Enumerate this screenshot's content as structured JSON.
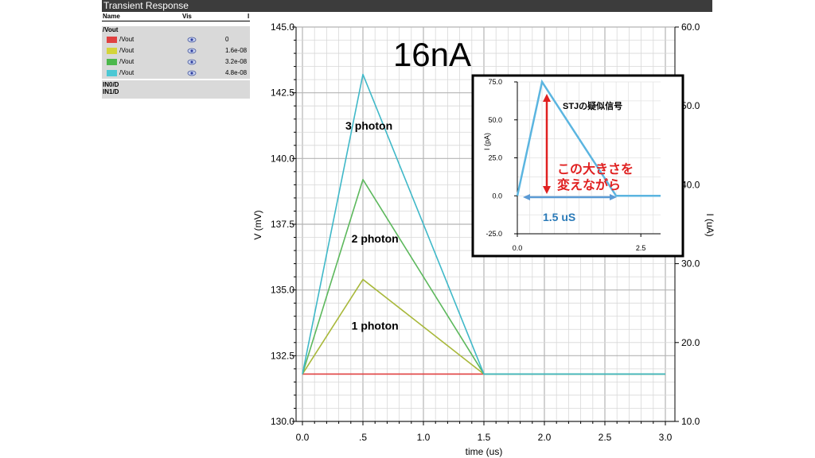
{
  "window": {
    "title": "Transient Response"
  },
  "legend": {
    "headers": {
      "name": "Name",
      "vis": "Vis",
      "i": "I"
    },
    "group": "/Vout",
    "rows": [
      {
        "name": "/Vout",
        "color": "#e04040",
        "value": "0"
      },
      {
        "name": "/Vout",
        "color": "#d4d43a",
        "value": "1.6e-08"
      },
      {
        "name": "/Vout",
        "color": "#4cb84c",
        "value": "3.2e-08"
      },
      {
        "name": "/Vout",
        "color": "#4cc8d4",
        "value": "4.8e-08"
      }
    ],
    "extra": [
      "IN0/D",
      "IN1/D"
    ]
  },
  "chart_data": [
    {
      "type": "line",
      "title": "16nA",
      "xlabel": "time (us)",
      "ylabel": "V (mV)",
      "y2label": "I (uA)",
      "xlim": [
        0.0,
        3.0
      ],
      "ylim": [
        130.0,
        145.0
      ],
      "y2lim": [
        10.0,
        60.0
      ],
      "x_ticks": [
        "0.0",
        ".5",
        "1.0",
        "1.5",
        "2.0",
        "2.5",
        "3.0"
      ],
      "y_ticks": [
        "130.0",
        "132.5",
        "135.0",
        "137.5",
        "140.0",
        "142.5",
        "145.0"
      ],
      "y2_ticks": [
        "10.0",
        "20.0",
        "30.0",
        "40.0",
        "50.0",
        "60.0"
      ],
      "grid": true,
      "series": [
        {
          "color": "#e04040",
          "x": [
            0.0,
            3.0
          ],
          "y": [
            131.8,
            131.8
          ]
        },
        {
          "color": "#a8b83a",
          "x": [
            0.0,
            0.5,
            1.5,
            3.0
          ],
          "y": [
            131.8,
            135.4,
            131.8,
            131.8
          ]
        },
        {
          "color": "#5cb85c",
          "x": [
            0.0,
            0.5,
            1.5,
            3.0
          ],
          "y": [
            131.8,
            139.2,
            131.8,
            131.8
          ]
        },
        {
          "color": "#3fb8c8",
          "x": [
            0.0,
            0.5,
            1.5,
            3.0
          ],
          "y": [
            131.8,
            143.2,
            131.8,
            131.8
          ]
        }
      ],
      "annotations": [
        {
          "text": "3 photon",
          "x": 0.55,
          "y": 141.1
        },
        {
          "text": "2 photon",
          "x": 0.6,
          "y": 136.8
        },
        {
          "text": "1 photon",
          "x": 0.6,
          "y": 133.5
        }
      ]
    },
    {
      "type": "line",
      "xlabel": "",
      "ylabel": "I (pA)",
      "xlim": [
        0.0,
        2.9
      ],
      "ylim": [
        -25.0,
        75.0
      ],
      "x_ticks": [
        "0.0",
        "2.5"
      ],
      "y_ticks": [
        "-25.0",
        "0.0",
        "25.0",
        "50.0",
        "75.0"
      ],
      "grid": true,
      "series": [
        {
          "color": "#5bb5e0",
          "x": [
            0.0,
            0.5,
            2.0,
            2.9
          ],
          "y": [
            0.0,
            75.0,
            0.0,
            0.0
          ]
        }
      ],
      "annotations": {
        "label": "STJの疑似信号",
        "red_text_1": "この大きさを",
        "red_text_2": "変えながら",
        "blue_text": "1.5 uS",
        "red_color": "#e02020",
        "blue_color": "#2a7ab8"
      }
    }
  ]
}
